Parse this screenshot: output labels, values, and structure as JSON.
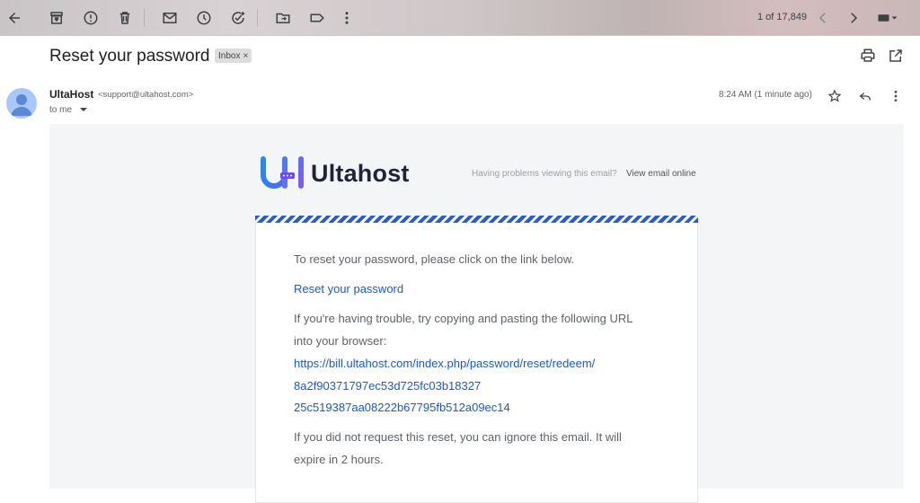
{
  "toolbar": {
    "buttons": [
      "back-icon",
      "archive-icon",
      "report-spam-icon",
      "delete-icon",
      "mark-unread-icon",
      "snooze-icon",
      "add-task-icon",
      "move-to-icon",
      "label-icon",
      "more-vert-icon"
    ],
    "count": "1 of 17,849"
  },
  "message": {
    "subject": "Reset your password",
    "label": "Inbox",
    "sender_name": "UltaHost",
    "sender_email": "<support@ultahost.com>",
    "to": "to me",
    "time": "8:24 AM (1 minute ago)"
  },
  "email": {
    "logo_mark": "UH",
    "logo_text": "Ultahost",
    "view_question": "Having problems viewing this email?",
    "view_link": "View email online",
    "intro": "To reset your password, please click on the link below.",
    "reset_link": "Reset your password",
    "trouble_line1": "If you're having trouble, try copying and pasting the following URL",
    "trouble_line2": "into your browser:",
    "url_line1": "https://bill.ultahost.com/index.php/password/reset/redeem/",
    "url_line2": "8a2f90371797ec53d725fc03b18327",
    "url_line3": "25c519387aa08222b67795fb512a09ec14",
    "ignore_line1": "If you did not request this reset, you can ignore this email. It will",
    "ignore_line2": "expire in 2 hours."
  },
  "colors": {
    "accent": "#2a5bd7",
    "link": "#1a5bc4"
  }
}
